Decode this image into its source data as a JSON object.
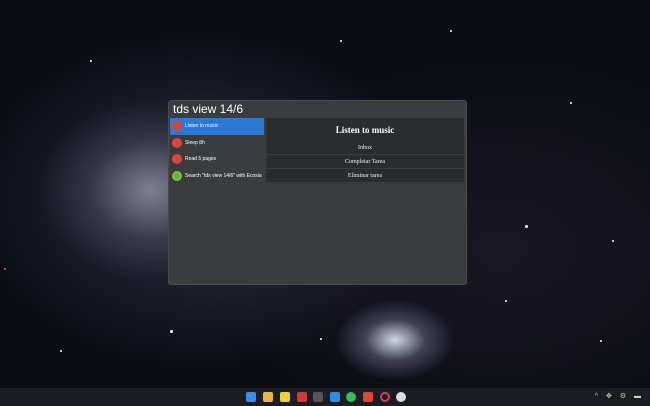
{
  "launcher": {
    "query": "tds view 14/6",
    "results": [
      {
        "label": "Listen to music",
        "icon": "todo-icon"
      },
      {
        "label": "Sleep 8h",
        "icon": "todo-icon"
      },
      {
        "label": "Read 5 pages",
        "icon": "todo-icon"
      },
      {
        "label": "Search \"tds view 14/6\" with Ecosia",
        "icon": "ecosia-icon"
      }
    ],
    "detail": {
      "title": "Listen to music",
      "actions": [
        "Inbox",
        "Completar Tarea",
        "Eliminar tarea"
      ]
    }
  },
  "taskbar": {
    "icons": [
      "windows-start",
      "file-explorer",
      "sticky-notes",
      "todoist",
      "terminal",
      "vscode",
      "spotify",
      "brave",
      "opera",
      "app"
    ],
    "tray": "^ ✥ ⚙ ▬"
  }
}
